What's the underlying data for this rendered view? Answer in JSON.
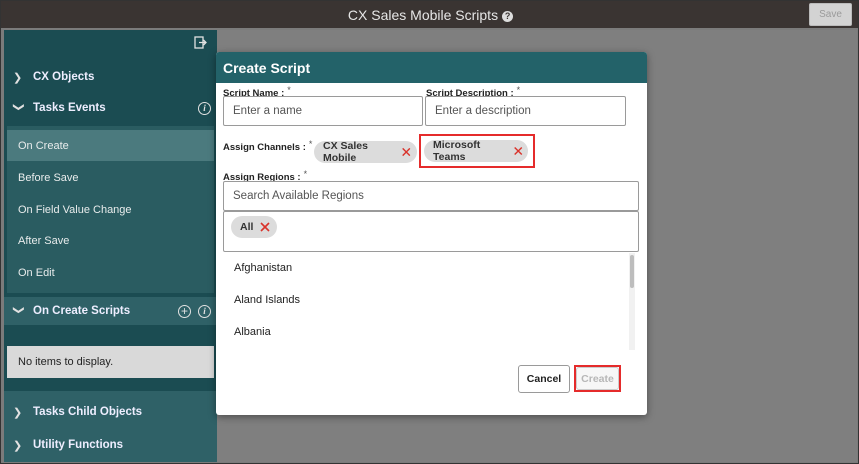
{
  "app": {
    "title": "CX Sales Mobile Scripts",
    "save_label": "Save"
  },
  "sidebar": {
    "sections": {
      "cx_objects": "CX Objects",
      "tasks_events": "Tasks Events",
      "on_create_scripts": "On Create Scripts",
      "tasks_child_objects": "Tasks Child Objects",
      "utility_functions": "Utility Functions"
    },
    "event_items": [
      "On Create",
      "Before Save",
      "On Field Value Change",
      "After Save",
      "On Edit"
    ],
    "active_item": "On Create",
    "empty_text": "No items to display."
  },
  "dialog": {
    "title": "Create Script",
    "script_name": {
      "label": "Script Name :",
      "required_mark": "*",
      "placeholder": "Enter a name",
      "value": ""
    },
    "script_description": {
      "label": "Script Description :",
      "required_mark": "*",
      "placeholder": "Enter a description",
      "value": ""
    },
    "channels": {
      "label": "Assign Channels :",
      "required_mark": "*",
      "selected": [
        "CX Sales Mobile",
        "Microsoft Teams"
      ]
    },
    "regions": {
      "label": "Assign Regions :",
      "required_mark": "*",
      "search_placeholder": "Search Available Regions",
      "selected": [
        "All"
      ],
      "available": [
        "Afghanistan",
        "Aland Islands",
        "Albania"
      ]
    },
    "buttons": {
      "cancel": "Cancel",
      "create": "Create"
    }
  },
  "colors": {
    "dialog_header": "#236269",
    "sidebar": "#1b4c52",
    "highlight_box": "#e52b2b",
    "remove_x": "#d9332b",
    "topbar": "#3a3432"
  }
}
